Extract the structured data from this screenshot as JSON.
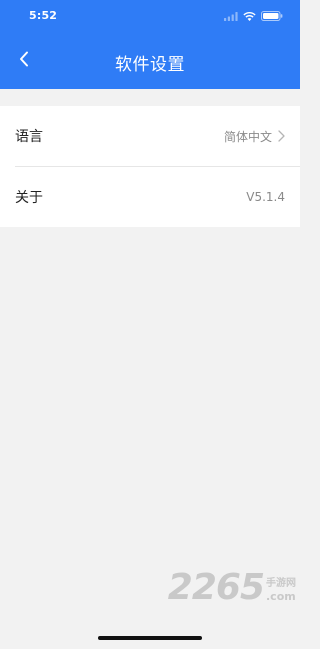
{
  "status_bar": {
    "time": "5:52",
    "icons": [
      "signal-icon",
      "wifi-icon",
      "battery-icon"
    ]
  },
  "nav": {
    "title": "软件设置",
    "back_icon": "chevron-left-icon"
  },
  "settings": {
    "items": [
      {
        "label": "语言",
        "value": "简体中文",
        "has_chevron": true
      },
      {
        "label": "关于",
        "value": "V5.1.4",
        "has_chevron": false
      }
    ]
  },
  "watermark": {
    "digits": "2265",
    "cn": "手游网",
    "com": ".com"
  },
  "colors": {
    "header": "#2f7cf6",
    "background": "#f2f2f2",
    "row_bg": "#ffffff",
    "value_text": "#8a8a8a"
  }
}
